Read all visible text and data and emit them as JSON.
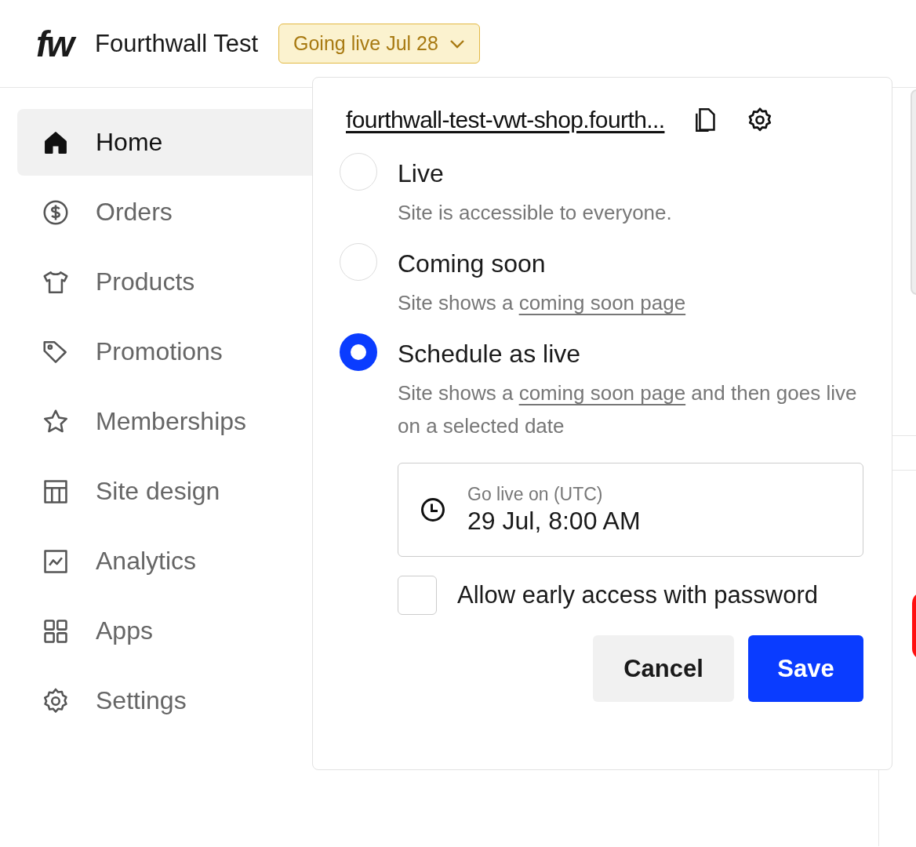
{
  "header": {
    "logo": "fw",
    "store_name": "Fourthwall Test",
    "status_button": "Going live Jul 28"
  },
  "sidebar": {
    "items": [
      {
        "label": "Home",
        "selected": true
      },
      {
        "label": "Orders",
        "selected": false
      },
      {
        "label": "Products",
        "selected": false
      },
      {
        "label": "Promotions",
        "selected": false
      },
      {
        "label": "Memberships",
        "selected": false
      },
      {
        "label": "Site design",
        "selected": false
      },
      {
        "label": "Analytics",
        "selected": false
      },
      {
        "label": "Apps",
        "selected": false
      },
      {
        "label": "Settings",
        "selected": false
      }
    ]
  },
  "popover": {
    "url": "fourthwall-test-vwt-shop.fourth...",
    "options": [
      {
        "title": "Live",
        "selected": false,
        "description": [
          {
            "kind": "text",
            "text": "Site is accessible to everyone."
          }
        ]
      },
      {
        "title": "Coming soon",
        "selected": false,
        "description": [
          {
            "kind": "text",
            "text": "Site shows a "
          },
          {
            "kind": "link",
            "text": "coming soon page"
          }
        ]
      },
      {
        "title": "Schedule as live",
        "selected": true,
        "description": [
          {
            "kind": "text",
            "text": "Site shows a "
          },
          {
            "kind": "link",
            "text": "coming soon page"
          },
          {
            "kind": "text",
            "text": " and then goes live on a selected date"
          }
        ]
      }
    ],
    "date_field": {
      "label": "Go live on (UTC)",
      "value": "29 Jul, 8:00 AM"
    },
    "early_access": {
      "label": "Allow early access with password",
      "checked": false
    },
    "buttons": {
      "cancel": "Cancel",
      "save": "Save"
    }
  }
}
